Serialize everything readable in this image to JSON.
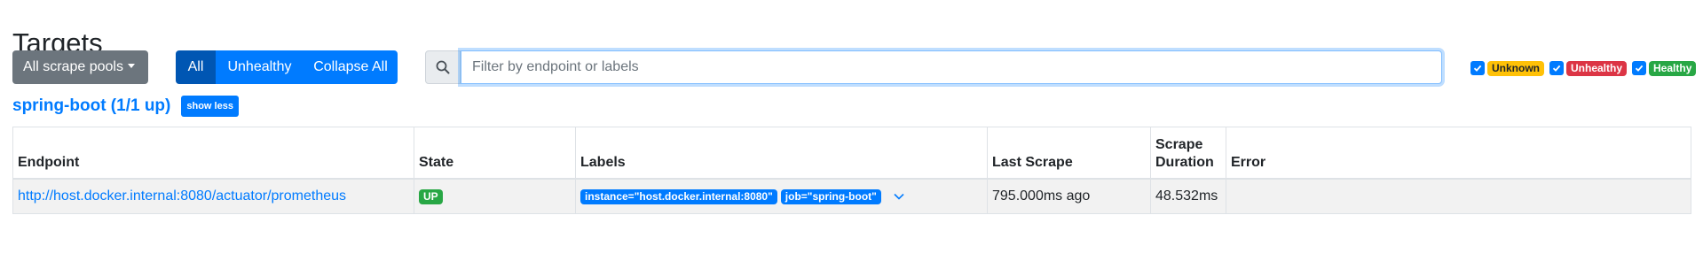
{
  "page": {
    "title": "Targets"
  },
  "toolbar": {
    "scrape_pools_label": "All scrape pools",
    "filter_all_label": "All",
    "filter_unhealthy_label": "Unhealthy",
    "collapse_all_label": "Collapse All",
    "search": {
      "placeholder": "Filter by endpoint or labels",
      "value": ""
    }
  },
  "health_filters": [
    {
      "label": "Unknown",
      "checked": true,
      "color": "#ffc107"
    },
    {
      "label": "Unhealthy",
      "checked": true,
      "color": "#dc3545"
    },
    {
      "label": "Healthy",
      "checked": true,
      "color": "#28a745"
    }
  ],
  "pool": {
    "title": "spring-boot (1/1 up)",
    "show_less_label": "show less",
    "columns": [
      "Endpoint",
      "State",
      "Labels",
      "Last Scrape",
      "Scrape Duration",
      "Error"
    ],
    "rows": [
      {
        "endpoint": "http://host.docker.internal:8080/actuator/prometheus",
        "state": "UP",
        "labels": [
          "instance=\"host.docker.internal:8080\"",
          "job=\"spring-boot\""
        ],
        "last_scrape": "795.000ms ago",
        "scrape_duration": "48.532ms",
        "error": ""
      }
    ]
  },
  "icons": {
    "search": "search-icon",
    "caret": "caret-down-icon",
    "checkbox": "check-icon",
    "expand": "chevron-down-icon"
  },
  "colors": {
    "primary": "#007bff",
    "primary_active": "#0056b3",
    "secondary": "#6c757d",
    "success": "#28a745",
    "danger": "#dc3545",
    "warning": "#ffc107"
  }
}
